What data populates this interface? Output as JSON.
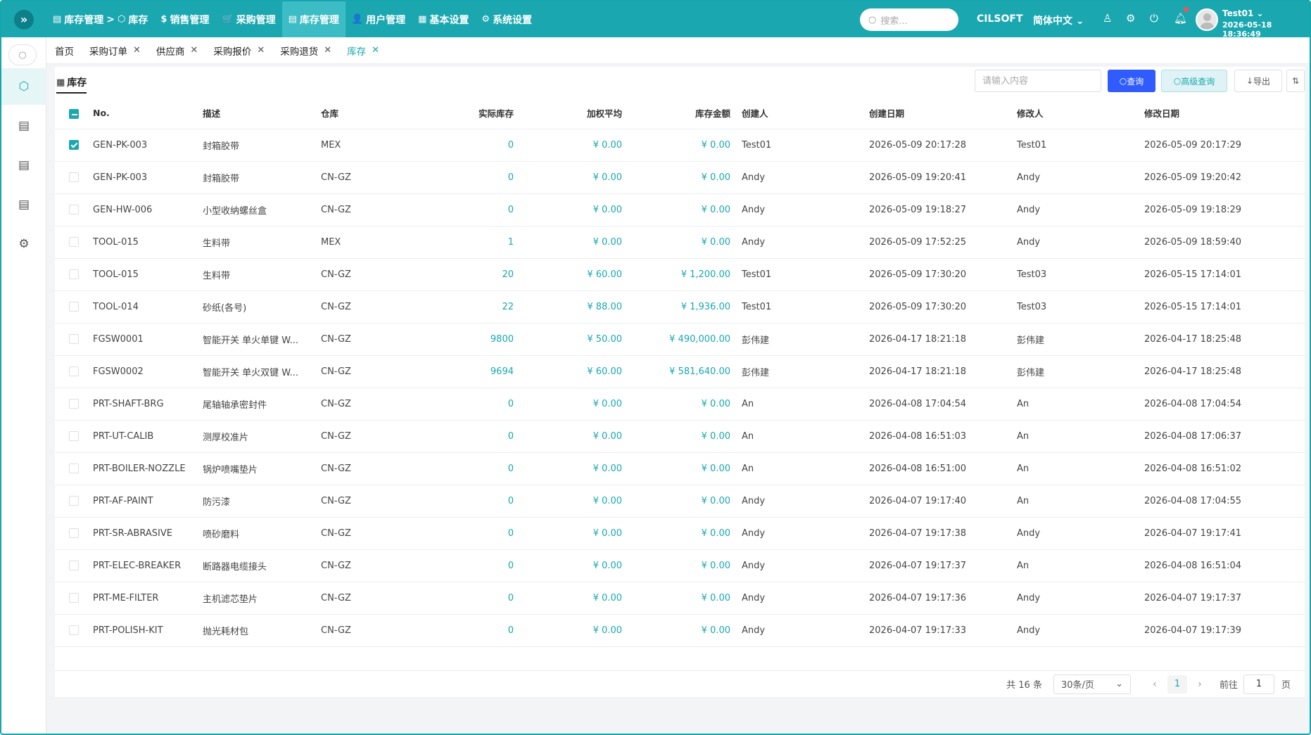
{
  "topbar": {
    "breadcrumb": [
      "库存管理",
      "库存"
    ],
    "breadcrumb_sep": ">",
    "menu": [
      {
        "label": "销售管理",
        "icon": "$"
      },
      {
        "label": "采购管理",
        "icon": "🛒"
      },
      {
        "label": "库存管理",
        "icon": "▤"
      },
      {
        "label": "用户管理",
        "icon": "👤"
      },
      {
        "label": "基本设置",
        "icon": "▦"
      },
      {
        "label": "系统设置",
        "icon": "⚙"
      }
    ],
    "search_placeholder": "搜索...",
    "brand": "CILSOFT",
    "language": "简体中文",
    "user_name": "Test01",
    "user_time": "2026-05-18 18:36:49"
  },
  "tabs": [
    {
      "label": "首页",
      "closable": false
    },
    {
      "label": "采购订单",
      "closable": true
    },
    {
      "label": "供应商",
      "closable": true
    },
    {
      "label": "采购报价",
      "closable": true
    },
    {
      "label": "采购退货",
      "closable": true
    },
    {
      "label": "库存",
      "closable": true,
      "active": true
    }
  ],
  "panel": {
    "title": "库存",
    "filter_placeholder": "请输入内容",
    "query_label": "查询",
    "advanced_label": "高级查询",
    "export_label": "导出"
  },
  "table": {
    "columns": [
      "No.",
      "描述",
      "仓库",
      "实际库存",
      "加权平均",
      "库存金额",
      "创建人",
      "创建日期",
      "修改人",
      "修改日期"
    ],
    "rows": [
      {
        "checked": true,
        "no": "GEN-PK-003",
        "desc": "封箱胶带",
        "wh": "MEX",
        "qty": "0",
        "avg": "¥ 0.00",
        "amt": "¥ 0.00",
        "creator": "Test01",
        "created": "2026-05-09 20:17:28",
        "modifier": "Test01",
        "modified": "2026-05-09 20:17:29"
      },
      {
        "checked": false,
        "no": "GEN-PK-003",
        "desc": "封箱胶带",
        "wh": "CN-GZ",
        "qty": "0",
        "avg": "¥ 0.00",
        "amt": "¥ 0.00",
        "creator": "Andy",
        "created": "2026-05-09 19:20:41",
        "modifier": "Andy",
        "modified": "2026-05-09 19:20:42"
      },
      {
        "checked": false,
        "no": "GEN-HW-006",
        "desc": "小型收纳螺丝盒",
        "wh": "CN-GZ",
        "qty": "0",
        "avg": "¥ 0.00",
        "amt": "¥ 0.00",
        "creator": "Andy",
        "created": "2026-05-09 19:18:27",
        "modifier": "Andy",
        "modified": "2026-05-09 19:18:29"
      },
      {
        "checked": false,
        "no": "TOOL-015",
        "desc": "生料带",
        "wh": "MEX",
        "qty": "1",
        "avg": "¥ 0.00",
        "amt": "¥ 0.00",
        "creator": "Andy",
        "created": "2026-05-09 17:52:25",
        "modifier": "Andy",
        "modified": "2026-05-09 18:59:40"
      },
      {
        "checked": false,
        "no": "TOOL-015",
        "desc": "生料带",
        "wh": "CN-GZ",
        "qty": "20",
        "avg": "¥ 60.00",
        "amt": "¥ 1,200.00",
        "creator": "Test01",
        "created": "2026-05-09 17:30:20",
        "modifier": "Test03",
        "modified": "2026-05-15 17:14:01"
      },
      {
        "checked": false,
        "no": "TOOL-014",
        "desc": "砂纸(各号)",
        "wh": "CN-GZ",
        "qty": "22",
        "avg": "¥ 88.00",
        "amt": "¥ 1,936.00",
        "creator": "Test01",
        "created": "2026-05-09 17:30:20",
        "modifier": "Test03",
        "modified": "2026-05-15 17:14:01"
      },
      {
        "checked": false,
        "no": "FGSW0001",
        "desc": "智能开关 单火单键 W...",
        "wh": "CN-GZ",
        "qty": "9800",
        "avg": "¥ 50.00",
        "amt": "¥ 490,000.00",
        "creator": "彭伟建",
        "created": "2026-04-17 18:21:18",
        "modifier": "彭伟建",
        "modified": "2026-04-17 18:25:48"
      },
      {
        "checked": false,
        "no": "FGSW0002",
        "desc": "智能开关 单火双键 W...",
        "wh": "CN-GZ",
        "qty": "9694",
        "avg": "¥ 60.00",
        "amt": "¥ 581,640.00",
        "creator": "彭伟建",
        "created": "2026-04-17 18:21:18",
        "modifier": "彭伟建",
        "modified": "2026-04-17 18:25:48"
      },
      {
        "checked": false,
        "no": "PRT-SHAFT-BRG",
        "desc": "尾轴轴承密封件",
        "wh": "CN-GZ",
        "qty": "0",
        "avg": "¥ 0.00",
        "amt": "¥ 0.00",
        "creator": "An",
        "created": "2026-04-08 17:04:54",
        "modifier": "An",
        "modified": "2026-04-08 17:04:54"
      },
      {
        "checked": false,
        "no": "PRT-UT-CALIB",
        "desc": "测厚校准片",
        "wh": "CN-GZ",
        "qty": "0",
        "avg": "¥ 0.00",
        "amt": "¥ 0.00",
        "creator": "An",
        "created": "2026-04-08 16:51:03",
        "modifier": "An",
        "modified": "2026-04-08 17:06:37"
      },
      {
        "checked": false,
        "no": "PRT-BOILER-NOZZLE",
        "desc": "锅炉喷嘴垫片",
        "wh": "CN-GZ",
        "qty": "0",
        "avg": "¥ 0.00",
        "amt": "¥ 0.00",
        "creator": "An",
        "created": "2026-04-08 16:51:00",
        "modifier": "An",
        "modified": "2026-04-08 16:51:02"
      },
      {
        "checked": false,
        "no": "PRT-AF-PAINT",
        "desc": "防污漆",
        "wh": "CN-GZ",
        "qty": "0",
        "avg": "¥ 0.00",
        "amt": "¥ 0.00",
        "creator": "Andy",
        "created": "2026-04-07 19:17:40",
        "modifier": "An",
        "modified": "2026-04-08 17:04:55"
      },
      {
        "checked": false,
        "no": "PRT-SR-ABRASIVE",
        "desc": "喷砂磨料",
        "wh": "CN-GZ",
        "qty": "0",
        "avg": "¥ 0.00",
        "amt": "¥ 0.00",
        "creator": "Andy",
        "created": "2026-04-07 19:17:38",
        "modifier": "Andy",
        "modified": "2026-04-07 19:17:41"
      },
      {
        "checked": false,
        "no": "PRT-ELEC-BREAKER",
        "desc": "断路器电缆接头",
        "wh": "CN-GZ",
        "qty": "0",
        "avg": "¥ 0.00",
        "amt": "¥ 0.00",
        "creator": "Andy",
        "created": "2026-04-07 19:17:37",
        "modifier": "An",
        "modified": "2026-04-08 16:51:04"
      },
      {
        "checked": false,
        "no": "PRT-ME-FILTER",
        "desc": "主机滤芯垫片",
        "wh": "CN-GZ",
        "qty": "0",
        "avg": "¥ 0.00",
        "amt": "¥ 0.00",
        "creator": "Andy",
        "created": "2026-04-07 19:17:36",
        "modifier": "Andy",
        "modified": "2026-04-07 19:17:37"
      },
      {
        "checked": false,
        "no": "PRT-POLISH-KIT",
        "desc": "抛光耗材包",
        "wh": "CN-GZ",
        "qty": "0",
        "avg": "¥ 0.00",
        "amt": "¥ 0.00",
        "creator": "Andy",
        "created": "2026-04-07 19:17:33",
        "modifier": "Andy",
        "modified": "2026-04-07 19:17:39"
      }
    ]
  },
  "pager": {
    "total": "共 16 条",
    "page_size": "30条/页",
    "current_page": "1",
    "goto_label": "前往",
    "goto_value": "1",
    "page_unit": "页"
  },
  "colors": {
    "primary": "#1aa7b0",
    "query_button": "#2f5bff"
  }
}
